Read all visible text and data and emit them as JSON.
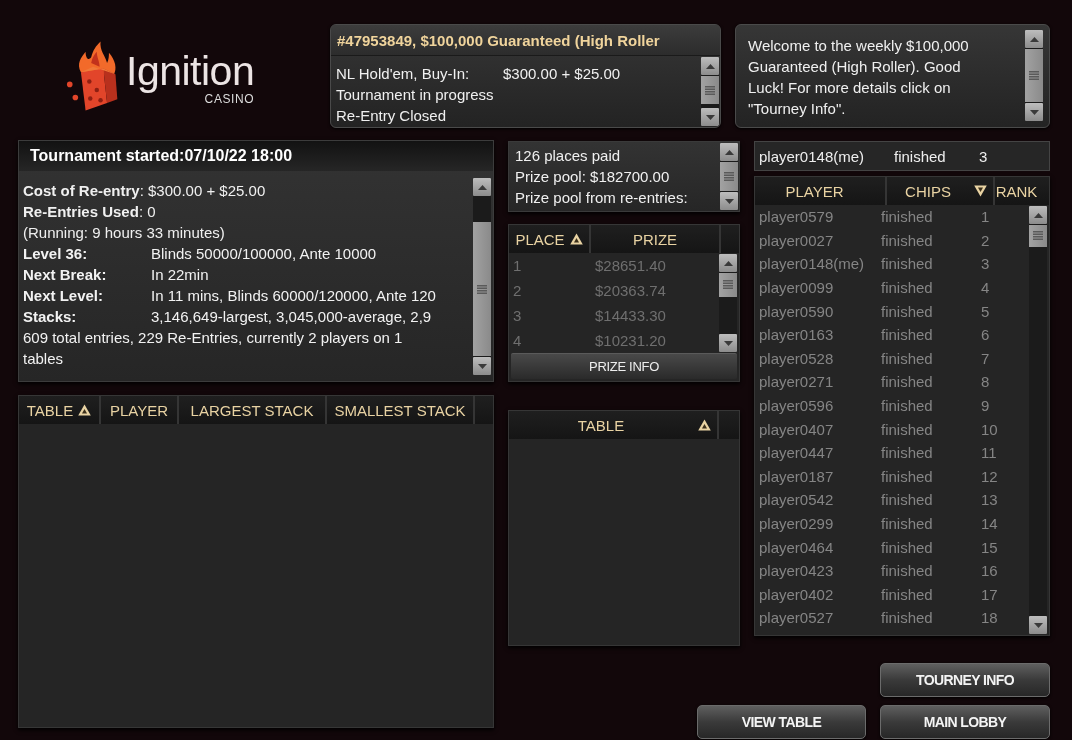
{
  "logo": {
    "wordmark": "Ignition",
    "tagline": "CASINO"
  },
  "tournament_header": {
    "title": "#47953849, $100,000 Guaranteed (High Roller",
    "lines": [
      {
        "text": "NL Hold'em, Buy-In:",
        "value": "$300.00 + $25.00"
      },
      {
        "text": "Tournament in progress"
      },
      {
        "text": "Re-Entry Closed"
      }
    ]
  },
  "welcome_message": "Welcome to the weekly $100,000 Guaranteed (High Roller). Good Luck! For more details click on \"Tourney Info\".",
  "tournament_info": {
    "title": "Tournament started:07/10/22 18:00",
    "lines": [
      "**Cost of Re-entry**: $300.00 + $25.00",
      "**Re-Entries Used**: 0",
      "(Running: 9 hours 33 minutes)"
    ],
    "details": [
      {
        "label": "Level 36:",
        "value": "Blinds 50000/100000, Ante 10000"
      },
      {
        "label": "Next Break:",
        "value": "In 22min"
      },
      {
        "label": "Next Level:",
        "value": "In 11 mins, Blinds 60000/120000, Ante 120"
      },
      {
        "label": "Stacks:",
        "value": "3,146,649-largest, 3,045,000-average, 2,9"
      }
    ],
    "summary": "609 total entries, 229 Re-Entries, currently 2 players on 1 tables"
  },
  "tables": {
    "columns": [
      {
        "label": "TABLE",
        "sorted": true,
        "descending": false
      },
      {
        "label": "PLAYER",
        "sorted": false
      },
      {
        "label": "LARGEST STACK",
        "sorted": false
      },
      {
        "label": "SMALLEST STACK",
        "sorted": false
      }
    ]
  },
  "prize_summary": [
    "126 places paid",
    "Prize pool: $182700.00",
    "Prize pool from re-entries:"
  ],
  "prizes": {
    "columns": [
      {
        "label": "PLACE",
        "sorted": true,
        "descending": false
      },
      {
        "label": "PRIZE",
        "sorted": false
      }
    ],
    "rows": [
      {
        "place": "1",
        "prize": "$28651.40"
      },
      {
        "place": "2",
        "prize": "$20363.74"
      },
      {
        "place": "3",
        "prize": "$14433.30"
      },
      {
        "place": "4",
        "prize": "$10231.20"
      }
    ],
    "button": "PRIZE INFO"
  },
  "table_list": {
    "columns": [
      {
        "label": "TABLE",
        "sorted": true,
        "descending": false
      }
    ]
  },
  "my_status": {
    "player": "player0148(me)",
    "chips": "finished",
    "rank": "3"
  },
  "players": {
    "columns": [
      {
        "label": "PLAYER",
        "sorted": false
      },
      {
        "label": "CHIPS",
        "sorted": true,
        "descending": true
      },
      {
        "label": "RANK",
        "sorted": false
      }
    ],
    "rows": [
      {
        "player": "player0579",
        "chips": "finished",
        "rank": "1"
      },
      {
        "player": "player0027",
        "chips": "finished",
        "rank": "2"
      },
      {
        "player": "player0148(me)",
        "chips": "finished",
        "rank": "3"
      },
      {
        "player": "player0099",
        "chips": "finished",
        "rank": "4"
      },
      {
        "player": "player0590",
        "chips": "finished",
        "rank": "5"
      },
      {
        "player": "player0163",
        "chips": "finished",
        "rank": "6"
      },
      {
        "player": "player0528",
        "chips": "finished",
        "rank": "7"
      },
      {
        "player": "player0271",
        "chips": "finished",
        "rank": "8"
      },
      {
        "player": "player0596",
        "chips": "finished",
        "rank": "9"
      },
      {
        "player": "player0407",
        "chips": "finished",
        "rank": "10"
      },
      {
        "player": "player0447",
        "chips": "finished",
        "rank": "11"
      },
      {
        "player": "player0187",
        "chips": "finished",
        "rank": "12"
      },
      {
        "player": "player0542",
        "chips": "finished",
        "rank": "13"
      },
      {
        "player": "player0299",
        "chips": "finished",
        "rank": "14"
      },
      {
        "player": "player0464",
        "chips": "finished",
        "rank": "15"
      },
      {
        "player": "player0423",
        "chips": "finished",
        "rank": "16"
      },
      {
        "player": "player0402",
        "chips": "finished",
        "rank": "17"
      },
      {
        "player": "player0527",
        "chips": "finished",
        "rank": "18"
      }
    ]
  },
  "actions": {
    "tourney_info": "TOURNEY INFO",
    "view_table": "VIEW TABLE",
    "main_lobby": "MAIN LOBBY"
  }
}
